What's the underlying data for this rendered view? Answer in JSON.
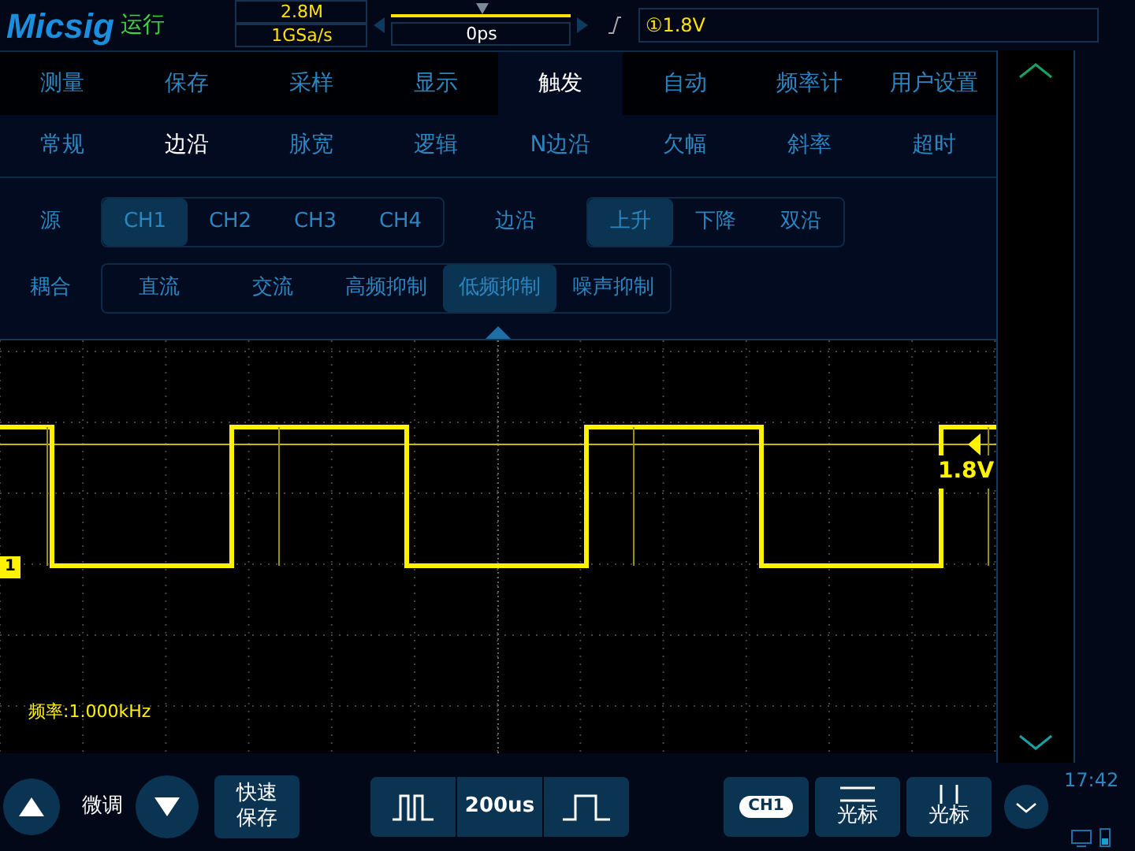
{
  "header": {
    "logo": "Micsig",
    "run_state": "运行",
    "memory": "2.8M",
    "sample_rate": "1GSa/s",
    "time_offset": "0ps",
    "trigger_readout": "①1.8V"
  },
  "menu_tabs": [
    {
      "label": "测量",
      "selected": false
    },
    {
      "label": "保存",
      "selected": false
    },
    {
      "label": "采样",
      "selected": false
    },
    {
      "label": "显示",
      "selected": false
    },
    {
      "label": "触发",
      "selected": true
    },
    {
      "label": "自动",
      "selected": false
    },
    {
      "label": "频率计",
      "selected": false
    },
    {
      "label": "用户设置",
      "selected": false
    }
  ],
  "trigger_types": [
    {
      "label": "常规",
      "selected": false
    },
    {
      "label": "边沿",
      "selected": true
    },
    {
      "label": "脉宽",
      "selected": false
    },
    {
      "label": "逻辑",
      "selected": false
    },
    {
      "label": "N边沿",
      "selected": false
    },
    {
      "label": "欠幅",
      "selected": false
    },
    {
      "label": "斜率",
      "selected": false
    },
    {
      "label": "超时",
      "selected": false
    }
  ],
  "source": {
    "label": "源",
    "options": [
      {
        "label": "CH1",
        "selected": true
      },
      {
        "label": "CH2",
        "selected": false
      },
      {
        "label": "CH3",
        "selected": false
      },
      {
        "label": "CH4",
        "selected": false
      }
    ]
  },
  "edge": {
    "label": "边沿",
    "options": [
      {
        "label": "上升",
        "selected": true
      },
      {
        "label": "下降",
        "selected": false
      },
      {
        "label": "双沿",
        "selected": false
      }
    ]
  },
  "coupling": {
    "label": "耦合",
    "options": [
      {
        "label": "直流",
        "selected": false
      },
      {
        "label": "交流",
        "selected": false
      },
      {
        "label": "高频抑制",
        "selected": false
      },
      {
        "label": "低频抑制",
        "selected": true
      },
      {
        "label": "噪声抑制",
        "selected": false
      }
    ]
  },
  "scope": {
    "channel_marker": "1",
    "trigger_level": "1.8V",
    "frequency": "频率:1.000kHz"
  },
  "bottom": {
    "fine_label": "微调",
    "quick_save": [
      "快速",
      "保存"
    ],
    "timebase": "200us",
    "channel": "CH1",
    "cursor_buttons": [
      {
        "label": "光标",
        "kind": "horizontal"
      },
      {
        "label": "光标",
        "kind": "vertical"
      }
    ],
    "time": "17:42"
  }
}
